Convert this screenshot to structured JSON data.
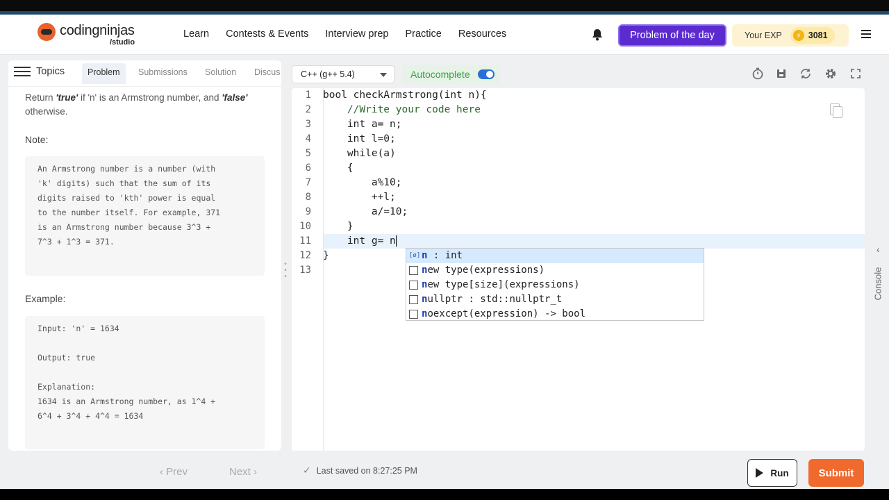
{
  "brand": {
    "name": "codingninjas",
    "sub": "/studio"
  },
  "nav": [
    "Learn",
    "Contests & Events",
    "Interview prep",
    "Practice",
    "Resources"
  ],
  "header": {
    "potd_label": "Problem of the day",
    "exp_label": "Your EXP",
    "exp_value": "3081"
  },
  "left": {
    "topics_label": "Topics",
    "tabs": [
      "Problem",
      "Submissions",
      "Solution",
      "Discus"
    ],
    "desc_pre": "Return ",
    "desc_true": "'true'",
    "desc_mid": " if 'n' is an Armstrong number, and ",
    "desc_false": "'false'",
    "desc_post": "otherwise.",
    "note_heading": "Note:",
    "note_text": "An Armstrong number is a number (with\n'k' digits) such that the sum of its\ndigits raised to 'kth' power is equal\nto the number itself. For example, 371\nis an Armstrong number because 3^3 +\n7^3 + 1^3 = 371.",
    "example_heading": "Example:",
    "example_text": "Input: 'n' = 1634\n\nOutput: true\n\nExplanation:\n1634 is an Armstrong number, as 1^4 +\n6^4 + 3^4 + 4^4 = 1634"
  },
  "toolbar": {
    "language": "C++ (g++ 5.4)",
    "autocomplete_label": "Autocomplete",
    "autocomplete_on": true
  },
  "editor": {
    "line_numbers": [
      "1",
      "2",
      "3",
      "4",
      "5",
      "6",
      "7",
      "8",
      "9",
      "10",
      "11",
      "12",
      "13"
    ],
    "lines": [
      "bool checkArmstrong(int n){",
      "    //Write your code here",
      "    int a= n;",
      "    int l=0;",
      "    while(a)",
      "    {",
      "        a%10;",
      "        ++l;",
      "        a/=10;",
      "    }",
      "    int g= n",
      "}",
      ""
    ],
    "autocomplete": [
      {
        "match": "n",
        "rest": " : int",
        "selected": true
      },
      {
        "match": "n",
        "rest": "ew type(expressions)",
        "selected": false
      },
      {
        "match": "n",
        "rest": "ew type[size](expressions)",
        "selected": false
      },
      {
        "match": "n",
        "rest": "ullptr : std::nullptr_t",
        "selected": false
      },
      {
        "match": "n",
        "rest": "oexcept(expression) -> bool",
        "selected": false
      }
    ]
  },
  "console_label": "Console",
  "footer": {
    "prev": "Prev",
    "next": "Next",
    "saved": "Last saved on 8:27:25 PM",
    "run": "Run",
    "submit": "Submit"
  }
}
